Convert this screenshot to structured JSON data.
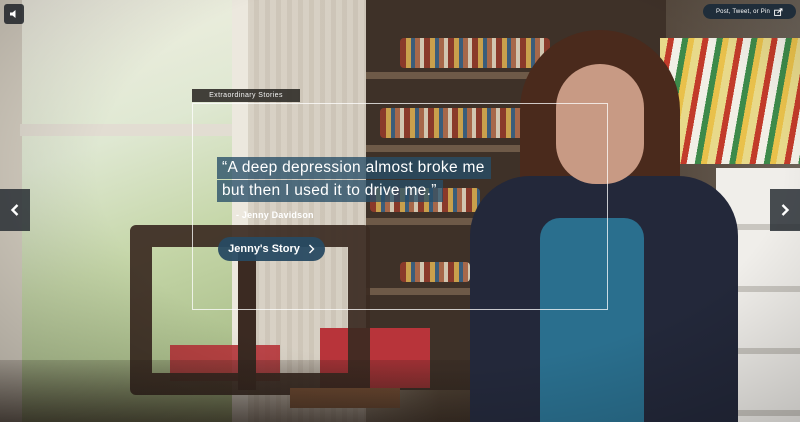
{
  "topbar": {
    "volume_icon": "speaker-icon",
    "share_label": "Post, Tweet, or Pin",
    "share_icon": "share-out-icon"
  },
  "story": {
    "tag": "Extraordinary Stories",
    "quote_line1": "“A deep depression almost broke me",
    "quote_line2": "but then I used it to drive me.”",
    "author": "- Jenny Davidson",
    "button_label": "Jenny's Story",
    "button_icon": "chevron-right-icon"
  },
  "nav": {
    "prev_icon": "chevron-left-icon",
    "next_icon": "chevron-right-icon"
  },
  "colors": {
    "accent": "#284e68",
    "share_bg": "#1f2d3a",
    "tag_bg": "#302c28"
  }
}
